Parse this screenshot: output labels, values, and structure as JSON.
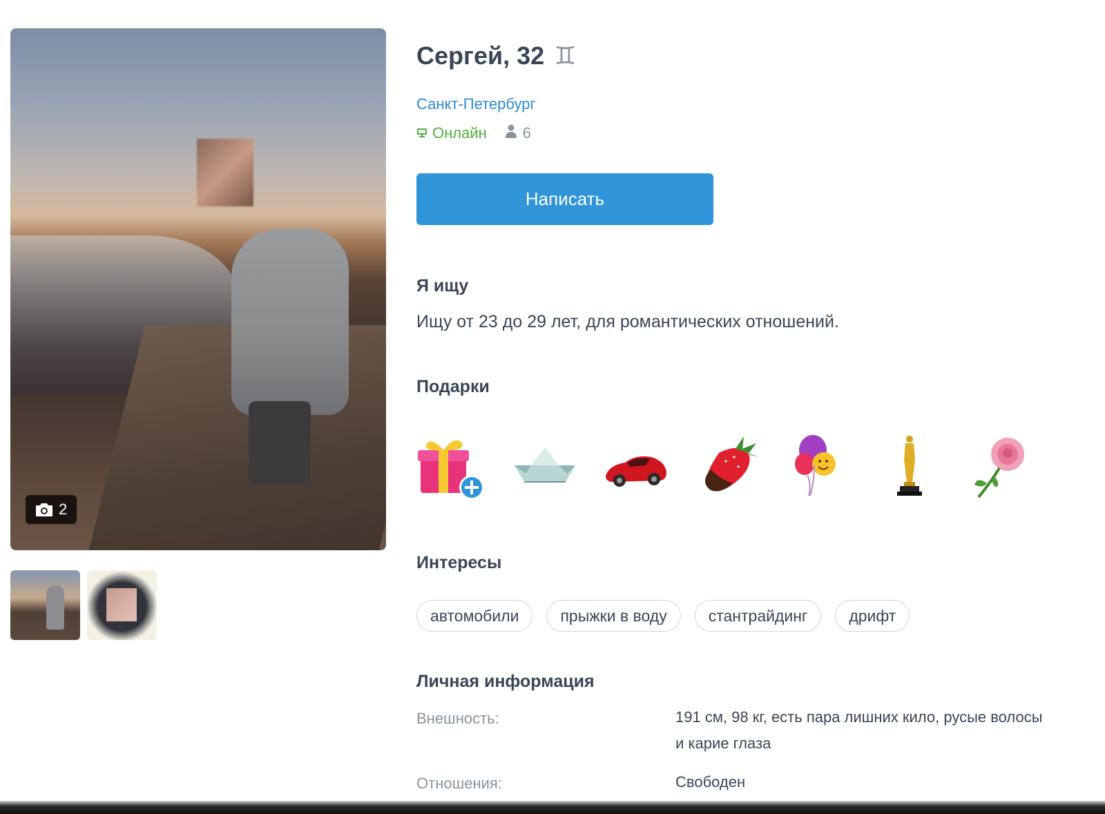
{
  "profile": {
    "name_age": "Сергей, 32",
    "zodiac_symbol": "♊",
    "city": "Санкт-Петербург",
    "status": "Онлайн",
    "views": "6",
    "write_button": "Написать"
  },
  "photos": {
    "count": "2"
  },
  "seeking": {
    "title": "Я ищу",
    "text": "Ищу от 23 до 29 лет, для романтических отношений."
  },
  "gifts": {
    "title": "Подарки",
    "items": [
      {
        "icon": "gift-box-add-icon"
      },
      {
        "icon": "paper-boat-icon"
      },
      {
        "icon": "red-car-icon"
      },
      {
        "icon": "chocolate-strawberry-icon"
      },
      {
        "icon": "balloons-icon"
      },
      {
        "icon": "oscar-statuette-icon"
      },
      {
        "icon": "rose-icon"
      }
    ]
  },
  "interests": {
    "title": "Интересы",
    "tags": [
      "автомобили",
      "прыжки в воду",
      "стантрайдинг",
      "дрифт"
    ]
  },
  "personal": {
    "title": "Личная информация",
    "rows": [
      {
        "label": "Внешность:",
        "value": "191 см, 98 кг, есть пара лишних кило, русые волосы и карие глаза"
      },
      {
        "label": "Отношения:",
        "value": "Свободен"
      }
    ]
  },
  "colors": {
    "accent": "#2f95d8",
    "link": "#2a8bd0",
    "online": "#4caf3a",
    "text": "#394656",
    "muted": "#8a939d"
  }
}
